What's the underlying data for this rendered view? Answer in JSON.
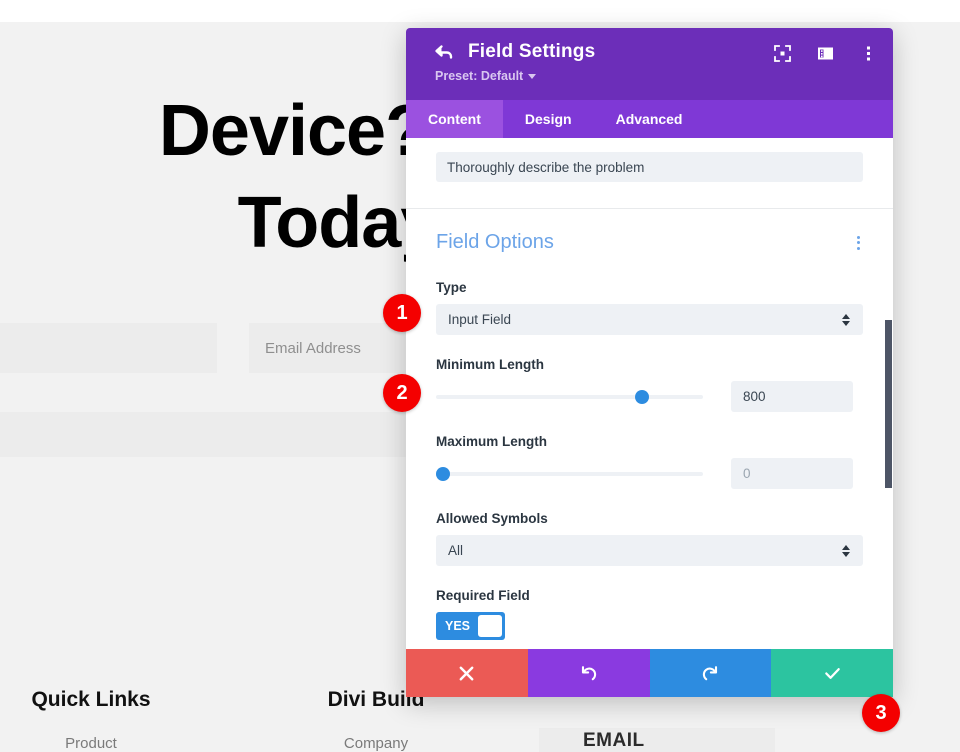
{
  "background": {
    "hero_line1": "Device? Co",
    "hero_line2": "Today!",
    "email_input_placeholder": "Email Address",
    "email_section_label": "EMAIL",
    "footer": {
      "columns": [
        {
          "heading": "Quick Links",
          "link": "Product"
        },
        {
          "heading": "Divi Build",
          "link": "Company"
        }
      ]
    }
  },
  "modal": {
    "header": {
      "back_icon": "back-arrow-icon",
      "title": "Field Settings",
      "preset_label": "Preset: Default",
      "icons": [
        {
          "name": "fullscreen-icon"
        },
        {
          "name": "layout-panel-icon"
        },
        {
          "name": "kebab-menu-icon"
        }
      ]
    },
    "tabs": [
      {
        "label": "Content",
        "active": true
      },
      {
        "label": "Design",
        "active": false
      },
      {
        "label": "Advanced",
        "active": false
      }
    ],
    "description_field": {
      "value": "Thoroughly describe the problem"
    },
    "field_options": {
      "section_title": "Field Options",
      "kebab_icon": "kebab-menu-icon",
      "type": {
        "label": "Type",
        "value": "Input Field"
      },
      "minimum_length": {
        "label": "Minimum Length",
        "value": "800",
        "slider_percent": 77
      },
      "maximum_length": {
        "label": "Maximum Length",
        "value": "0",
        "slider_percent": 0
      },
      "allowed_symbols": {
        "label": "Allowed Symbols",
        "value": "All"
      },
      "required_field": {
        "label": "Required Field",
        "toggle_text": "YES"
      }
    },
    "footer_buttons": [
      {
        "name": "cancel-button",
        "icon": "close-icon",
        "color": "#eb5a55"
      },
      {
        "name": "undo-button",
        "icon": "undo-icon",
        "color": "#8a3ae0"
      },
      {
        "name": "redo-button",
        "icon": "redo-icon",
        "color": "#2d8ce0"
      },
      {
        "name": "save-button",
        "icon": "check-icon",
        "color": "#2cc4a0"
      }
    ]
  },
  "annotations": [
    {
      "number": "1"
    },
    {
      "number": "2"
    },
    {
      "number": "3"
    }
  ],
  "colors": {
    "header_purple": "#6c2eb9",
    "tabbar_purple": "#7f38d6",
    "tab_active_purple": "#9b51e0",
    "accent_blue": "#2d8ce0",
    "section_title_blue": "#6ca4e8",
    "badge_red": "#f40000"
  }
}
